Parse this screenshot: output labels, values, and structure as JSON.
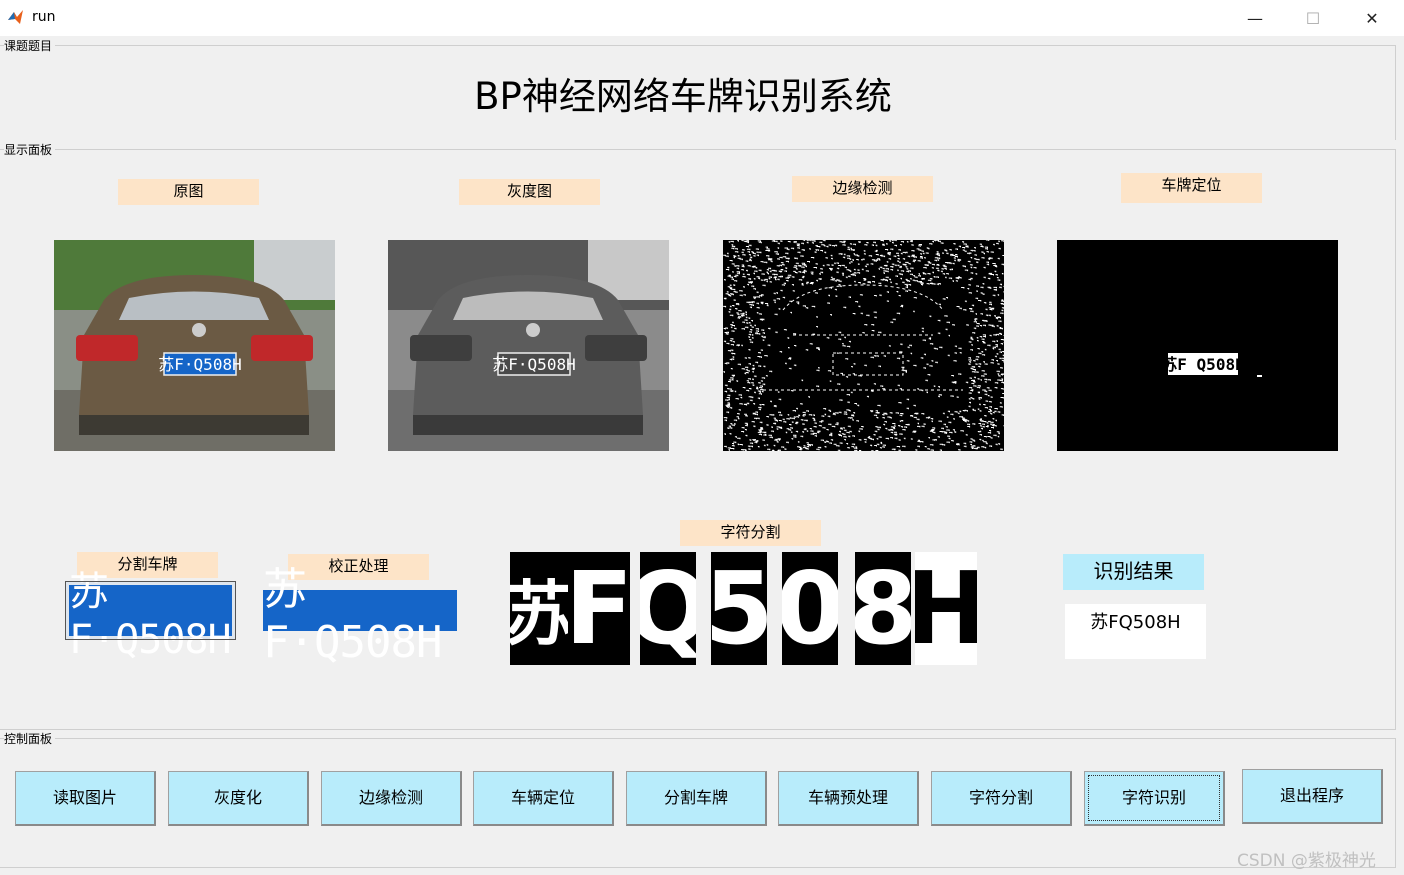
{
  "window": {
    "title": "run"
  },
  "panels": {
    "topic": "课题题目",
    "display": "显示面板",
    "control": "控制面板"
  },
  "main_title": "BP神经网络车牌识别系统",
  "captions": {
    "original": "原图",
    "grayscale": "灰度图",
    "edge": "边缘检测",
    "locate": "车牌定位",
    "split_plate": "分割车牌",
    "correct": "校正处理",
    "char_seg": "字符分割",
    "result_label": "识别结果"
  },
  "plate_text": "苏F·Q508H",
  "located_plate_text": "苏F Q508H",
  "car_plate_text": "苏F·Q508H",
  "segments": [
    "苏",
    "F",
    "Q",
    "5",
    "0",
    "8",
    "H"
  ],
  "result_value": "苏FQ508H",
  "buttons": [
    "读取图片",
    "灰度化",
    "边缘检测",
    "车辆定位",
    "分割车牌",
    "车辆预处理",
    "字符分割",
    "字符识别",
    "退出程序"
  ],
  "watermark": "CSDN @紫极神光"
}
